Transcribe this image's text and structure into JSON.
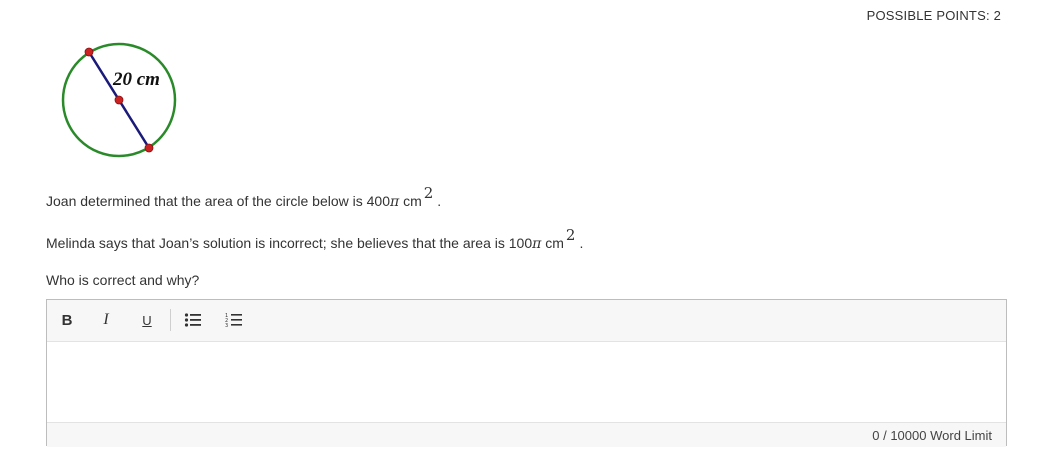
{
  "header": {
    "possible_points": "POSSIBLE POINTS: 2"
  },
  "diagram": {
    "diameter_label": "20 cm",
    "colors": {
      "circle": "#2a8a2a",
      "diameter": "#1a1a7a",
      "point": "#cc2222"
    }
  },
  "question": {
    "line1_text": "Joan determined that the area of the circle below is 400",
    "line1_pi": "π",
    "line1_unit": " cm",
    "line1_exp": "2",
    "line1_end": ".",
    "line2_text": "Melinda says that Joan’s solution is incorrect; she believes that the area is 100",
    "line2_pi": "π",
    "line2_unit": " cm",
    "line2_exp": "2",
    "line2_end": ".",
    "line3_text": "Who is correct and why?"
  },
  "editor": {
    "toolbar": {
      "bold_label": "B",
      "italic_label": "I",
      "underline_label": "U",
      "bullet_icon": "bulleted-list-icon",
      "numbered_icon": "numbered-list-icon"
    },
    "content": "",
    "word_count": "0",
    "word_separator": "/",
    "word_limit": "10000",
    "word_limit_label": "Word Limit"
  }
}
